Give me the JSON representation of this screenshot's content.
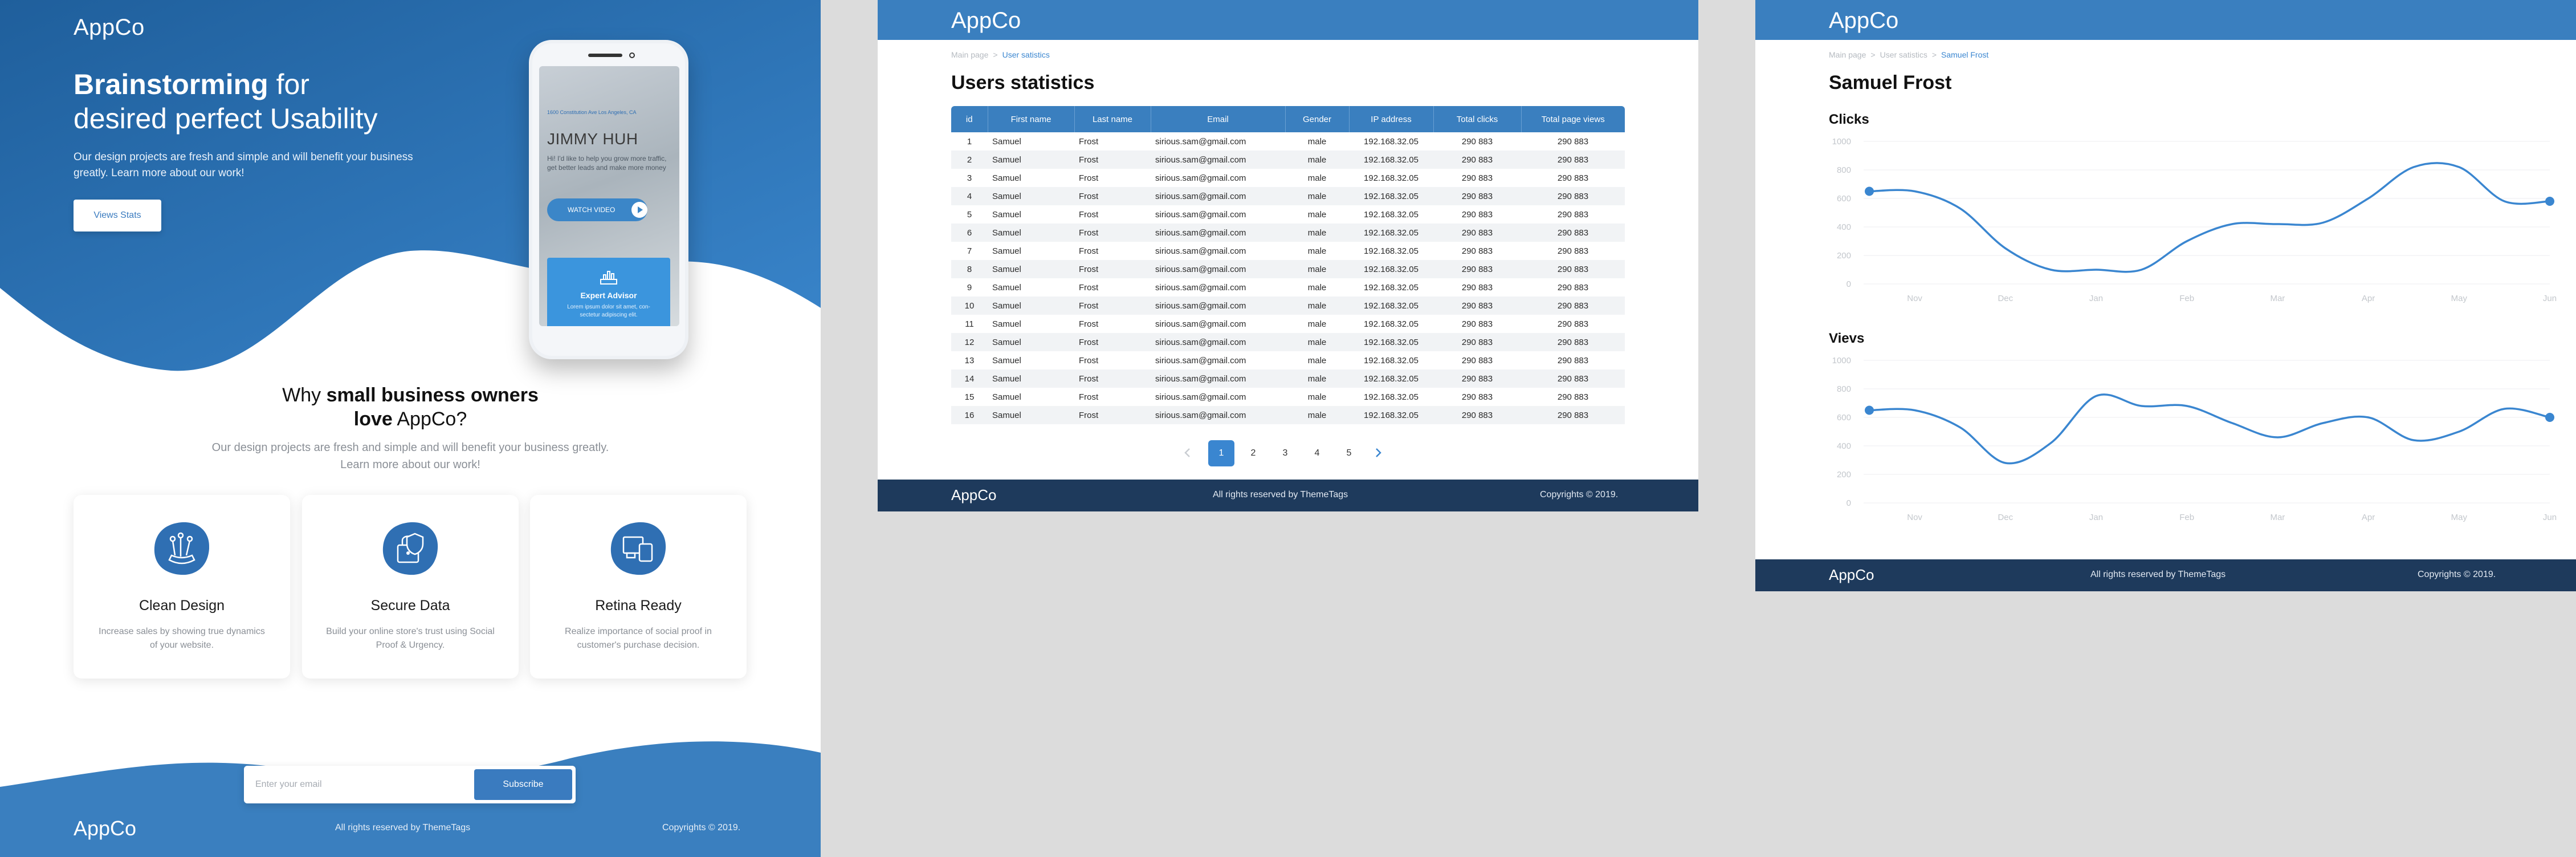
{
  "landing": {
    "logo": "AppCo",
    "hero": {
      "title_bold": "Brainstorming",
      "title_rest": " for",
      "title_line2": "desired perfect Usability",
      "desc": "Our design projects are fresh and simple and will benefit your business greatly. Learn more about our work!",
      "button": "Views Stats"
    },
    "phone": {
      "address": "1600 Constitution Ave Los Angeles, CA",
      "name": "JIMMY HUH",
      "text": "Hi! I'd like to help you grow more traffic, get better leads and make more money",
      "watch": "WATCH VIDEO",
      "advisor_title": "Expert Advisor",
      "advisor_text": "Lorem ipsum dolor sit amet, con-sectetur adipiscing elit."
    },
    "why": {
      "pre": "Why ",
      "bold1": "small business owners",
      "bold2": "love",
      "post": " AppCo?",
      "desc": "Our design projects are fresh and simple and will benefit your business greatly. Learn more about our work!"
    },
    "features": [
      {
        "title": "Clean Design",
        "text": "Increase sales by showing true dynamics of your website.",
        "icon": "clean-design-icon"
      },
      {
        "title": "Secure Data",
        "text": "Build your online store's trust using Social Proof & Urgency.",
        "icon": "secure-data-icon"
      },
      {
        "title": "Retina Ready",
        "text": "Realize importance of social proof in customer's purchase decision.",
        "icon": "retina-ready-icon"
      }
    ],
    "subscribe": {
      "placeholder": "Enter your email",
      "button": "Subscribe"
    },
    "footer": {
      "logo": "AppCo",
      "rights": "All rights reserved by ThemeTags",
      "copy": "Copyrights © 2019."
    }
  },
  "stats": {
    "logo": "AppCo",
    "breadcrumb": [
      "Main page",
      "User satistics"
    ],
    "title": "Users statistics",
    "columns": [
      "id",
      "First name",
      "Last name",
      "Email",
      "Gender",
      "IP address",
      "Total clicks",
      "Total page views"
    ],
    "rows": [
      [
        "1",
        "Samuel",
        "Frost",
        "sirious.sam@gmail.com",
        "male",
        "192.168.32.05",
        "290 883",
        "290 883"
      ],
      [
        "2",
        "Samuel",
        "Frost",
        "sirious.sam@gmail.com",
        "male",
        "192.168.32.05",
        "290 883",
        "290 883"
      ],
      [
        "3",
        "Samuel",
        "Frost",
        "sirious.sam@gmail.com",
        "male",
        "192.168.32.05",
        "290 883",
        "290 883"
      ],
      [
        "4",
        "Samuel",
        "Frost",
        "sirious.sam@gmail.com",
        "male",
        "192.168.32.05",
        "290 883",
        "290 883"
      ],
      [
        "5",
        "Samuel",
        "Frost",
        "sirious.sam@gmail.com",
        "male",
        "192.168.32.05",
        "290 883",
        "290 883"
      ],
      [
        "6",
        "Samuel",
        "Frost",
        "sirious.sam@gmail.com",
        "male",
        "192.168.32.05",
        "290 883",
        "290 883"
      ],
      [
        "7",
        "Samuel",
        "Frost",
        "sirious.sam@gmail.com",
        "male",
        "192.168.32.05",
        "290 883",
        "290 883"
      ],
      [
        "8",
        "Samuel",
        "Frost",
        "sirious.sam@gmail.com",
        "male",
        "192.168.32.05",
        "290 883",
        "290 883"
      ],
      [
        "9",
        "Samuel",
        "Frost",
        "sirious.sam@gmail.com",
        "male",
        "192.168.32.05",
        "290 883",
        "290 883"
      ],
      [
        "10",
        "Samuel",
        "Frost",
        "sirious.sam@gmail.com",
        "male",
        "192.168.32.05",
        "290 883",
        "290 883"
      ],
      [
        "11",
        "Samuel",
        "Frost",
        "sirious.sam@gmail.com",
        "male",
        "192.168.32.05",
        "290 883",
        "290 883"
      ],
      [
        "12",
        "Samuel",
        "Frost",
        "sirious.sam@gmail.com",
        "male",
        "192.168.32.05",
        "290 883",
        "290 883"
      ],
      [
        "13",
        "Samuel",
        "Frost",
        "sirious.sam@gmail.com",
        "male",
        "192.168.32.05",
        "290 883",
        "290 883"
      ],
      [
        "14",
        "Samuel",
        "Frost",
        "sirious.sam@gmail.com",
        "male",
        "192.168.32.05",
        "290 883",
        "290 883"
      ],
      [
        "15",
        "Samuel",
        "Frost",
        "sirious.sam@gmail.com",
        "male",
        "192.168.32.05",
        "290 883",
        "290 883"
      ],
      [
        "16",
        "Samuel",
        "Frost",
        "sirious.sam@gmail.com",
        "male",
        "192.168.32.05",
        "290 883",
        "290 883"
      ]
    ],
    "pages": [
      "1",
      "2",
      "3",
      "4",
      "5"
    ],
    "active_page": "1",
    "footer": {
      "logo": "AppCo",
      "rights": "All rights reserved by ThemeTags",
      "copy": "Copyrights © 2019."
    }
  },
  "user": {
    "logo": "AppCo",
    "breadcrumb": [
      "Main page",
      "User satistics",
      "Samuel Frost"
    ],
    "title": "Samuel Frost",
    "footer": {
      "logo": "AppCo",
      "rights": "All rights reserved by ThemeTags",
      "copy": "Copyrights © 2019."
    }
  },
  "colors": {
    "primary": "#3a7fbf",
    "dark": "#1e3a5c",
    "line": "#3a86d0"
  },
  "chart_data": [
    {
      "type": "line",
      "title": "Clicks",
      "categories": [
        "Nov",
        "Dec",
        "Jan",
        "Feb",
        "Mar",
        "Apr",
        "May",
        "Jun"
      ],
      "x": [
        0,
        0.5,
        1,
        1.5,
        2,
        2.5,
        3,
        3.5,
        4,
        4.5,
        5,
        5.5,
        6,
        6.5,
        7,
        7.5
      ],
      "values": [
        650,
        650,
        530,
        250,
        100,
        100,
        100,
        300,
        420,
        420,
        430,
        600,
        820,
        820,
        580,
        580
      ],
      "ylim": [
        0,
        1000
      ],
      "yticks": [
        "0",
        "200",
        "400",
        "600",
        "800",
        "1000"
      ],
      "grid": true
    },
    {
      "type": "line",
      "title": "Vievs",
      "categories": [
        "Nov",
        "Dec",
        "Jan",
        "Feb",
        "Mar",
        "Apr",
        "May",
        "Jun"
      ],
      "x": [
        0,
        0.5,
        1,
        1.5,
        2,
        2.5,
        3,
        3.5,
        4,
        4.5,
        5,
        5.5,
        6,
        6.5,
        7,
        7.5
      ],
      "values": [
        650,
        650,
        530,
        280,
        420,
        750,
        680,
        680,
        560,
        460,
        560,
        600,
        440,
        500,
        660,
        600
      ],
      "ylim": [
        0,
        1000
      ],
      "yticks": [
        "0",
        "200",
        "400",
        "600",
        "800",
        "1000"
      ],
      "grid": true
    }
  ]
}
